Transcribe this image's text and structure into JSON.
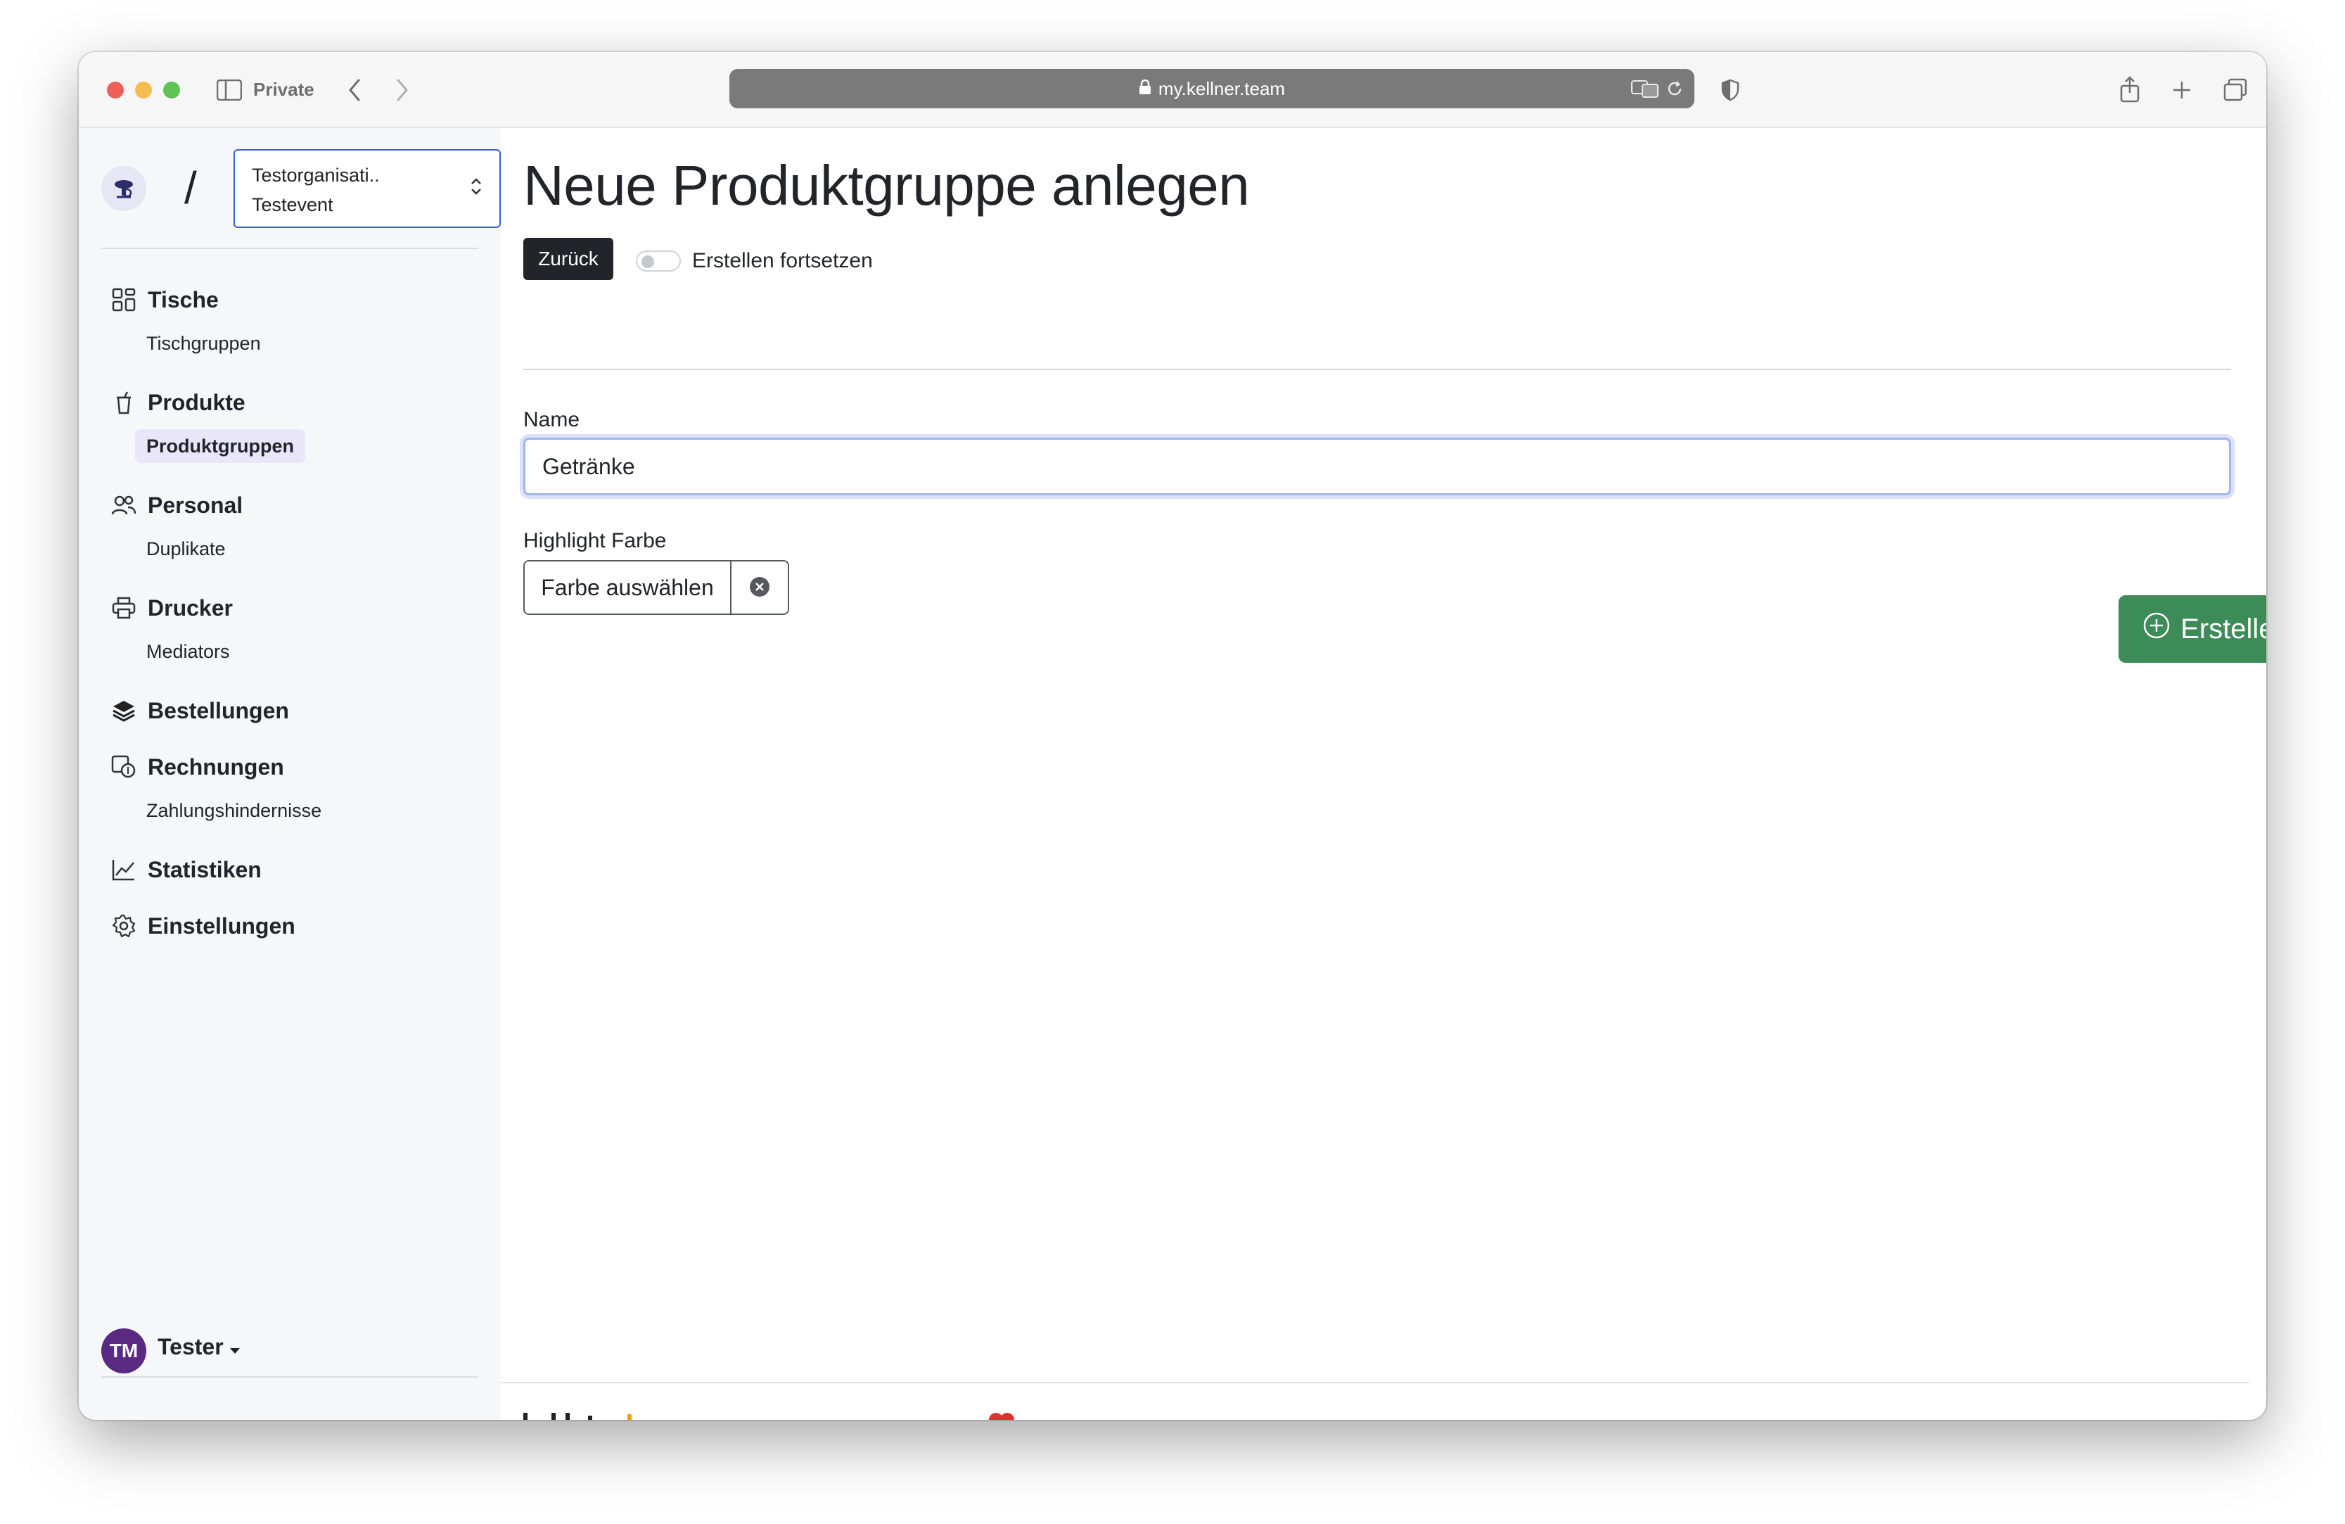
{
  "browser": {
    "private_label": "Private",
    "url": "my.kellner.team"
  },
  "sidebar": {
    "org_name": "Testorganisati..",
    "event_name": "Testevent",
    "slash": "/",
    "nav": {
      "tische": "Tische",
      "tischgruppen": "Tischgruppen",
      "produkte": "Produkte",
      "produktgruppen": "Produktgruppen",
      "personal": "Personal",
      "duplikate": "Duplikate",
      "drucker": "Drucker",
      "mediators": "Mediators",
      "bestellungen": "Bestellungen",
      "rechnungen": "Rechnungen",
      "zahlungshindernisse": "Zahlungshindernisse",
      "statistiken": "Statistiken",
      "einstellungen": "Einstellungen"
    },
    "user": {
      "initials": "TM",
      "name": "Tester"
    }
  },
  "main": {
    "title": "Neue Produktgruppe anlegen",
    "back_label": "Zurück",
    "continue_label": "Erstellen fortsetzen",
    "name_label": "Name",
    "name_value": "Getränke",
    "color_label": "Highlight Farbe",
    "color_pick_label": "Farbe auswählen",
    "create_label": "Erstellen"
  },
  "colors": {
    "accent_active_bg": "#e9e6fa",
    "create_button": "#3d8b57",
    "back_button": "#212529",
    "avatar": "#5a2a82"
  }
}
